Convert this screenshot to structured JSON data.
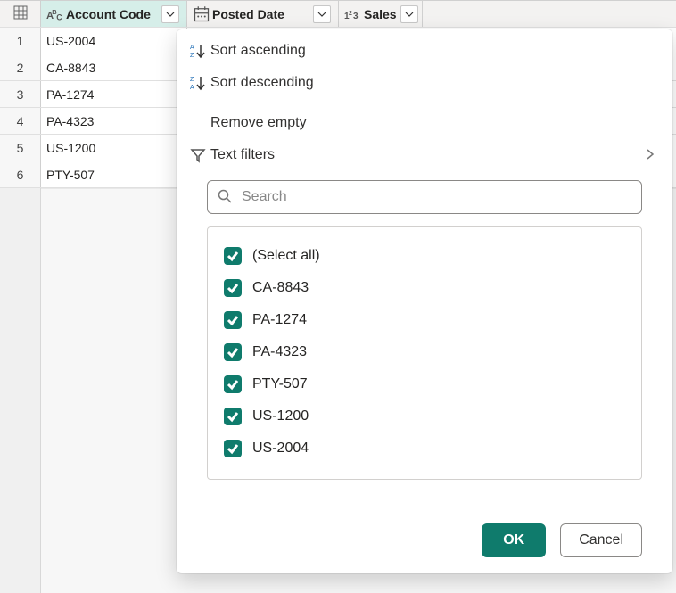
{
  "columns": {
    "account_code": {
      "label": "Account Code"
    },
    "posted_date": {
      "label": "Posted Date"
    },
    "sales": {
      "label": "Sales"
    }
  },
  "rows": [
    {
      "n": "1",
      "account_code": "US-2004"
    },
    {
      "n": "2",
      "account_code": "CA-8843"
    },
    {
      "n": "3",
      "account_code": "PA-1274"
    },
    {
      "n": "4",
      "account_code": "PA-4323"
    },
    {
      "n": "5",
      "account_code": "US-1200"
    },
    {
      "n": "6",
      "account_code": "PTY-507"
    }
  ],
  "filter_panel": {
    "sort_asc": "Sort ascending",
    "sort_desc": "Sort descending",
    "remove_empty": "Remove empty",
    "text_filters": "Text filters",
    "search_placeholder": "Search",
    "items": [
      {
        "label": "(Select all)",
        "checked": true
      },
      {
        "label": "CA-8843",
        "checked": true
      },
      {
        "label": "PA-1274",
        "checked": true
      },
      {
        "label": "PA-4323",
        "checked": true
      },
      {
        "label": "PTY-507",
        "checked": true
      },
      {
        "label": "US-1200",
        "checked": true
      },
      {
        "label": "US-2004",
        "checked": true
      }
    ],
    "ok": "OK",
    "cancel": "Cancel"
  }
}
